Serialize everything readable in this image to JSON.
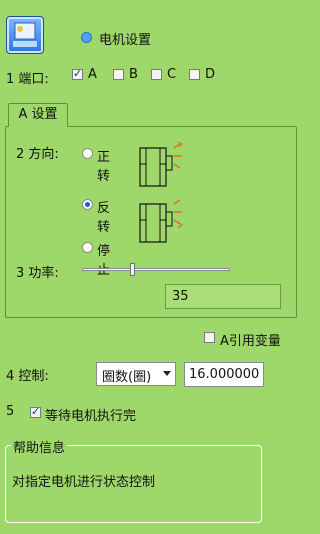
{
  "header": {
    "title": "电机设置"
  },
  "port": {
    "label": "1 端口:",
    "options": [
      {
        "label": "A",
        "checked": true
      },
      {
        "label": "B",
        "checked": false
      },
      {
        "label": "C",
        "checked": false
      },
      {
        "label": "D",
        "checked": false
      }
    ]
  },
  "tab": {
    "label": "A 设置"
  },
  "direction": {
    "label": "2 方向:",
    "options": [
      {
        "label": "正转",
        "selected": false
      },
      {
        "label": "反转",
        "selected": true
      },
      {
        "label": "停止",
        "selected": false
      }
    ]
  },
  "power": {
    "label": "3 功率:",
    "value": "35",
    "slider_fraction": 0.35
  },
  "reference": {
    "label": "A引用变量",
    "checked": false
  },
  "control": {
    "label": "4 控制:",
    "mode": "圈数(圈)",
    "amount": "16.000000"
  },
  "wait": {
    "number": "5",
    "label": "等待电机执行完",
    "checked": true
  },
  "help": {
    "title": "帮助信息",
    "text": "对指定电机进行状态控制"
  }
}
